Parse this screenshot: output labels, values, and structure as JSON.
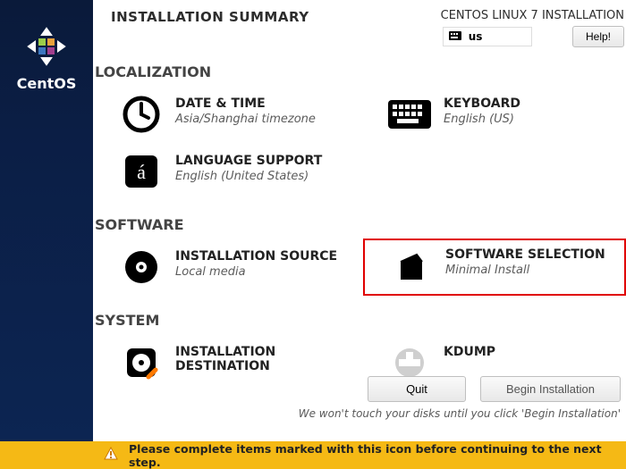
{
  "brand": "CentOS",
  "header": {
    "title": "INSTALLATION SUMMARY",
    "subtitle": "CENTOS LINUX 7 INSTALLATION",
    "keyboard_layout": "us",
    "help_label": "Help!"
  },
  "sections": {
    "localization": {
      "title": "LOCALIZATION",
      "datetime": {
        "title": "DATE & TIME",
        "sub": "Asia/Shanghai timezone"
      },
      "keyboard": {
        "title": "KEYBOARD",
        "sub": "English (US)"
      },
      "language": {
        "title": "LANGUAGE SUPPORT",
        "sub": "English (United States)"
      }
    },
    "software": {
      "title": "SOFTWARE",
      "source": {
        "title": "INSTALLATION SOURCE",
        "sub": "Local media"
      },
      "selection": {
        "title": "SOFTWARE SELECTION",
        "sub": "Minimal Install"
      }
    },
    "system": {
      "title": "SYSTEM",
      "destination": {
        "title": "INSTALLATION DESTINATION",
        "sub": ""
      },
      "kdump": {
        "title": "KDUMP",
        "sub": ""
      }
    }
  },
  "buttons": {
    "quit": "Quit",
    "begin": "Begin Installation"
  },
  "hint": "We won't touch your disks until you click 'Begin Installation'",
  "warning": "Please complete items marked with this icon before continuing to the next step."
}
